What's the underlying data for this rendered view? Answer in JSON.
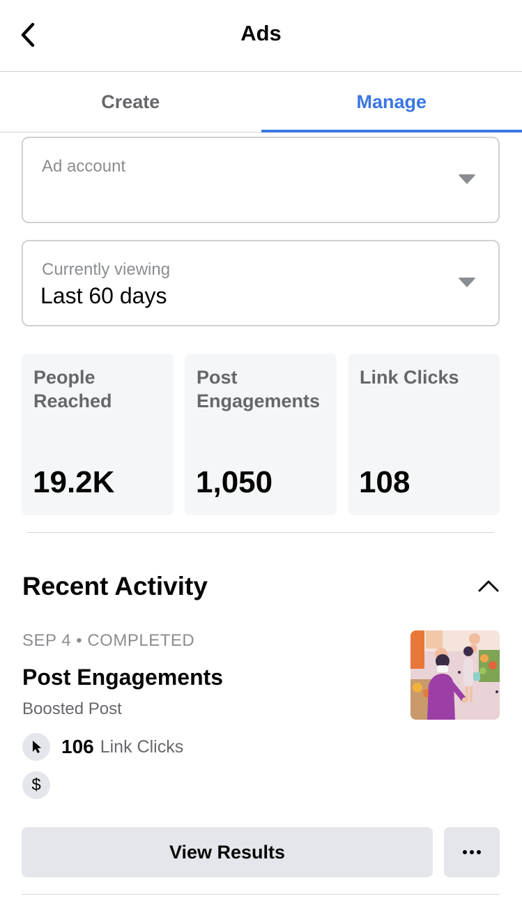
{
  "header": {
    "title": "Ads",
    "back_icon": "chevron-left-icon"
  },
  "tabs": [
    {
      "label": "Create",
      "active": false
    },
    {
      "label": "Manage",
      "active": true
    }
  ],
  "ad_account": {
    "label": "Ad account",
    "value": ""
  },
  "viewing": {
    "label": "Currently viewing",
    "value": "Last 60 days"
  },
  "stats": [
    {
      "label": "People Reached",
      "value": "19.2K"
    },
    {
      "label": "Post Engagements",
      "value": "1,050"
    },
    {
      "label": "Link Clicks",
      "value": "108"
    }
  ],
  "recent_activity": {
    "title": "Recent Activity",
    "item": {
      "meta": "SEP 4 • COMPLETED",
      "title": "Post Engagements",
      "subtitle": "Boosted Post",
      "link_clicks_value": "106",
      "link_clicks_label": "Link Clicks",
      "spend_icon_text": "$",
      "view_results_label": "View Results"
    }
  },
  "colors": {
    "accent": "#3b76e1",
    "muted": "#65676b",
    "button_bg": "#e4e6eb",
    "card_bg": "#f5f6f7"
  }
}
